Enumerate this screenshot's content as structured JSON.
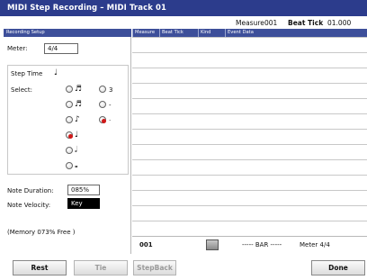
{
  "title": "MIDI Step Recording – MIDI Track 01",
  "measure": {
    "label": "Measure",
    "value": "001",
    "beat_label": "Beat Tick",
    "beat_value": "01.000"
  },
  "left_header": "Recording Setup",
  "columns": [
    "Measure",
    "Beat Tick",
    "Kind",
    "Event Data"
  ],
  "meter": {
    "label": "Meter:",
    "value": "4/4"
  },
  "step_time": {
    "label": "Step Time",
    "current_glyph": "♩"
  },
  "select": {
    "label": "Select:",
    "options": [
      {
        "glyph": "♬",
        "selected": false
      },
      {
        "glyph": "3",
        "selected": false
      },
      {
        "glyph": "♬",
        "selected": false
      },
      {
        "glyph": "-",
        "selected": false
      },
      {
        "glyph": "♪",
        "selected": false
      },
      {
        "glyph": ".",
        "selected": true
      },
      {
        "glyph": "♩",
        "selected": true
      },
      {
        "glyph": "𝅗𝅥",
        "selected": false
      },
      {
        "glyph": "𝅝",
        "selected": false
      }
    ]
  },
  "note_duration": {
    "label": "Note Duration:",
    "value": "085%"
  },
  "note_velocity": {
    "label": "Note Velocity:",
    "value": "Key"
  },
  "memory": {
    "text": "(Memory   073% Free   )"
  },
  "status": {
    "measure": "001",
    "bar_text": "----- BAR -----",
    "meter_text": "Meter  4/4"
  },
  "buttons": {
    "rest": "Rest",
    "tie": "Tie",
    "stepback": "StepBack",
    "done": "Done"
  },
  "colors": {
    "title_bg": "#2c3c8c",
    "header_bg": "#3d4f9a",
    "radio_on": "#d01818"
  }
}
